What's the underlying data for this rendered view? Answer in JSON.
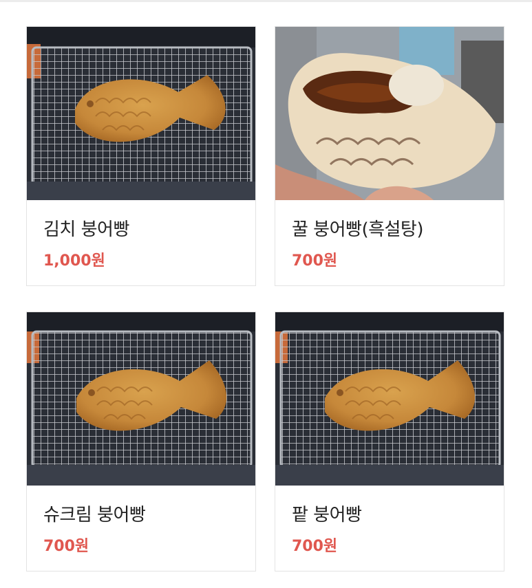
{
  "menu": {
    "items": [
      {
        "name": "김치 붕어빵",
        "price": "1,000원",
        "photo": "grilled-fish-bread"
      },
      {
        "name": "꿀 붕어빵(흑설탕)",
        "price": "700원",
        "photo": "bitten-fish-bread"
      },
      {
        "name": "슈크림 붕어빵",
        "price": "700원",
        "photo": "grilled-fish-bread"
      },
      {
        "name": "팥 붕어빵",
        "price": "700원",
        "photo": "grilled-fish-bread"
      }
    ]
  },
  "colors": {
    "price": "#e0574f",
    "name": "#222222",
    "border": "#e3e3e3"
  }
}
